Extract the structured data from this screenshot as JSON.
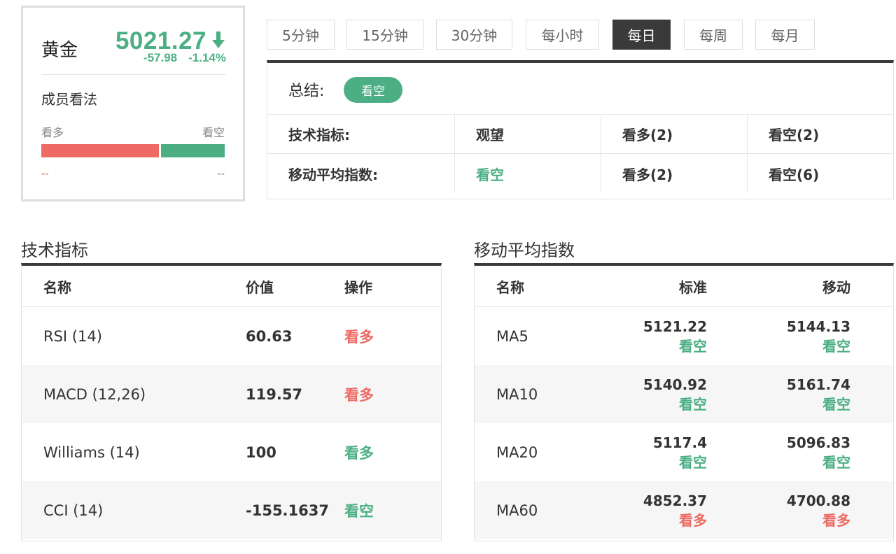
{
  "quote": {
    "name": "黄金",
    "price": "5021.27",
    "direction_icon": "arrow-down-icon",
    "change": "-57.98",
    "change_pct": "-1.14%",
    "opinion_title": "成员看法",
    "bull_label": "看多",
    "bear_label": "看空",
    "bull_value": "--",
    "bear_value": "--",
    "bull_share": 0.64
  },
  "tabs": [
    {
      "label": "5分钟",
      "active": false
    },
    {
      "label": "15分钟",
      "active": false
    },
    {
      "label": "30分钟",
      "active": false
    },
    {
      "label": "每小时",
      "active": false
    },
    {
      "label": "每日",
      "active": true
    },
    {
      "label": "每周",
      "active": false
    },
    {
      "label": "每月",
      "active": false
    }
  ],
  "summary": {
    "label": "总结:",
    "verdict": "看空",
    "rows": [
      {
        "name": "技术指标:",
        "overall": "观望",
        "bull": "看多(2)",
        "bear": "看空(2)"
      },
      {
        "name": "移动平均指数:",
        "overall": "看空",
        "bull": "看多(2)",
        "bear": "看空(6)"
      }
    ]
  },
  "tech": {
    "title": "技术指标",
    "headers": {
      "name": "名称",
      "value": "价值",
      "action": "操作"
    },
    "rows": [
      {
        "name": "RSI (14)",
        "value": "60.63",
        "action": "看多",
        "tone": "red"
      },
      {
        "name": "MACD (12,26)",
        "value": "119.57",
        "action": "看多",
        "tone": "red"
      },
      {
        "name": "Williams (14)",
        "value": "100",
        "action": "看多",
        "tone": "green"
      },
      {
        "name": "CCI (14)",
        "value": "-155.1637",
        "action": "看空",
        "tone": "green"
      }
    ]
  },
  "ma": {
    "title": "移动平均指数",
    "headers": {
      "name": "名称",
      "standard": "标准",
      "moving": "移动"
    },
    "rows": [
      {
        "name": "MA5",
        "standard": "5121.22",
        "standard_signal": "看空",
        "standard_tone": "green",
        "moving": "5144.13",
        "moving_signal": "看空",
        "moving_tone": "green"
      },
      {
        "name": "MA10",
        "standard": "5140.92",
        "standard_signal": "看空",
        "standard_tone": "green",
        "moving": "5161.74",
        "moving_signal": "看空",
        "moving_tone": "green"
      },
      {
        "name": "MA20",
        "standard": "5117.4",
        "standard_signal": "看空",
        "standard_tone": "green",
        "moving": "5096.83",
        "moving_signal": "看空",
        "moving_tone": "green"
      },
      {
        "name": "MA60",
        "standard": "4852.37",
        "standard_signal": "看多",
        "standard_tone": "red",
        "moving": "4700.88",
        "moving_signal": "看多",
        "moving_tone": "red"
      }
    ]
  },
  "colors": {
    "bull": "#ee6a64",
    "bear": "#4caf84",
    "active_tab": "#3a3a3a"
  }
}
